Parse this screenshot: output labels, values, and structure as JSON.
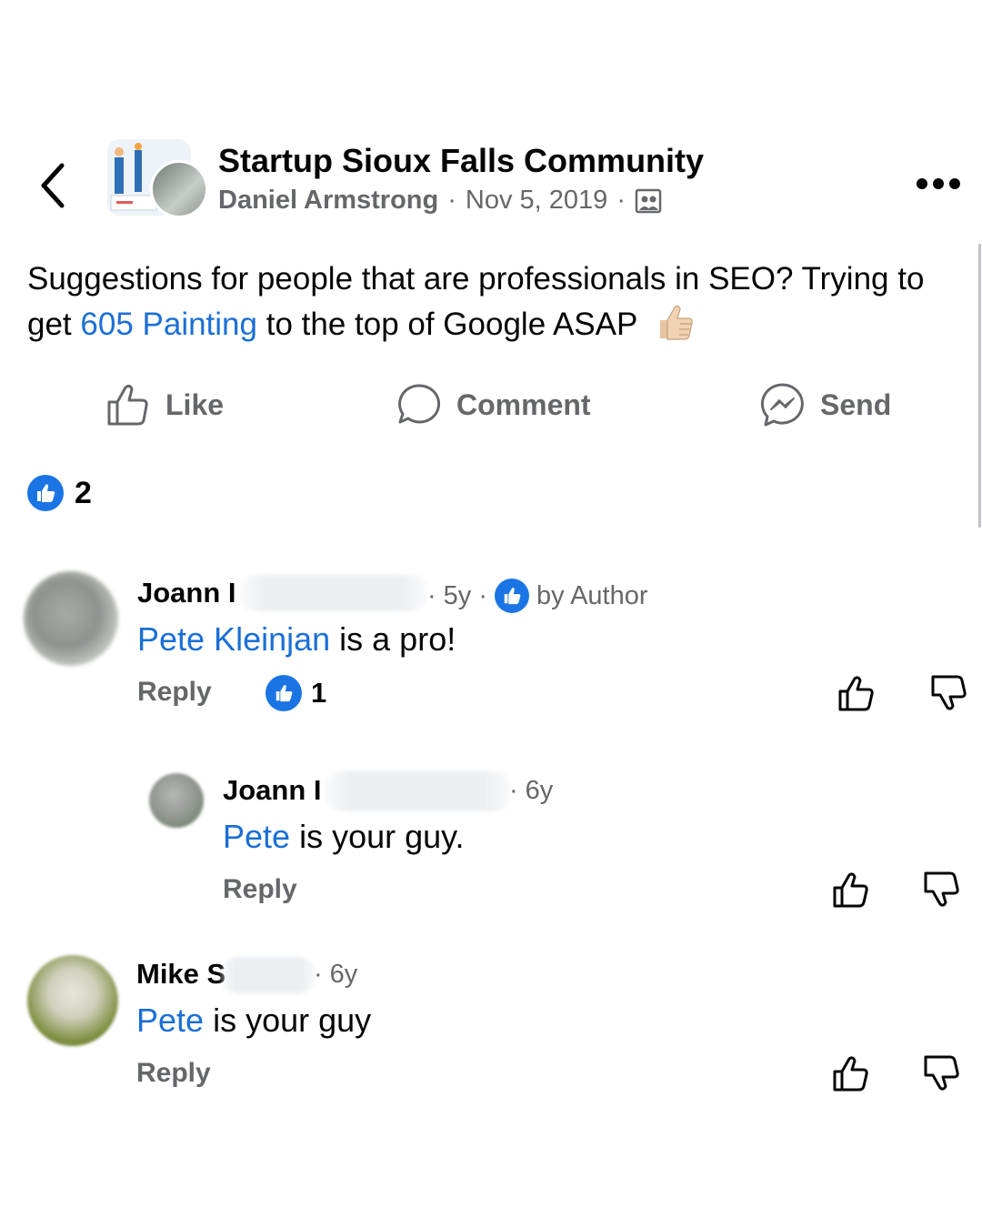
{
  "header": {
    "group_name": "Startup Sioux Falls Community",
    "author": "Daniel Armstrong",
    "separator": "·",
    "date": "Nov 5, 2019"
  },
  "post": {
    "text_before": "Suggestions for people that are professionals in SEO? Trying to get ",
    "mention": "605 Painting",
    "text_after": " to the top of Google ASAP"
  },
  "actions": {
    "like": "Like",
    "comment": "Comment",
    "send": "Send"
  },
  "reactions": {
    "count": "2"
  },
  "comments": [
    {
      "name": "Joann",
      "name_partial": "Joann I",
      "time": "5y",
      "badge": "by Author",
      "mention": "Pete Kleinjan",
      "text": " is a pro!",
      "reply": "Reply",
      "like_count": "1"
    },
    {
      "name_partial": "Joann I",
      "time": "6y",
      "mention": "Pete",
      "text": " is your guy.",
      "reply": "Reply"
    },
    {
      "name_partial": "Mike S",
      "time": "6y",
      "mention": "Pete",
      "text": " is your guy",
      "reply": "Reply"
    }
  ],
  "icons": {
    "back": "chevron-left-icon",
    "more": "more-horizontal-icon",
    "group": "group-icon",
    "like": "thumbs-up-icon",
    "comment": "comment-bubble-icon",
    "send": "messenger-icon",
    "upvote": "thumbs-up-outline-icon",
    "downvote": "thumbs-down-outline-icon"
  },
  "colors": {
    "link": "#1b6fd6",
    "like_blue": "#1b74e4",
    "secondary_text": "#65676b"
  }
}
